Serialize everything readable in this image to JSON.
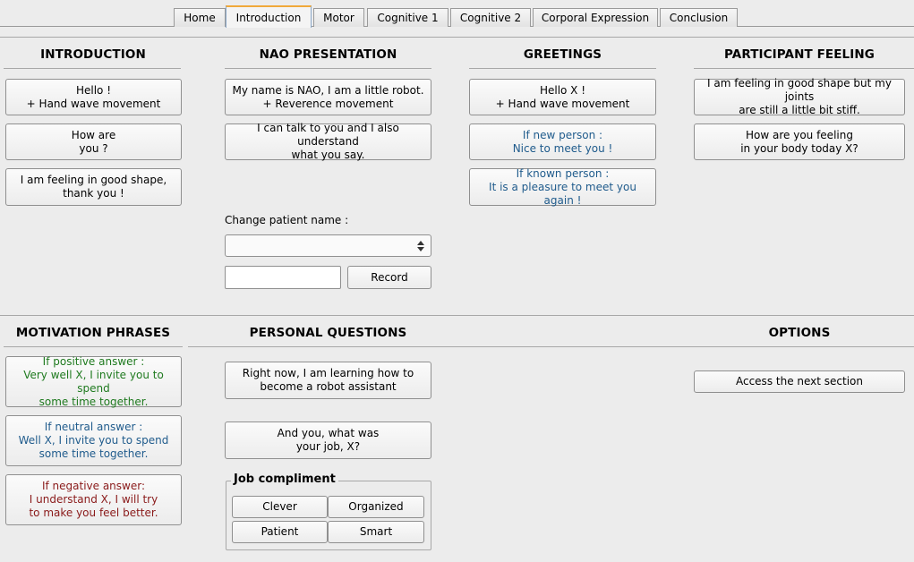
{
  "tabs": [
    "Home",
    "Introduction",
    "Motor",
    "Cognitive 1",
    "Cognitive 2",
    "Corporal Expression",
    "Conclusion"
  ],
  "active_tab": "Introduction",
  "sections": {
    "introduction": {
      "title": "INTRODUCTION",
      "buttons": [
        "Hello !\n+ Hand wave movement",
        "How are\nyou ?",
        "I am feeling in good shape,\nthank you !"
      ]
    },
    "nao_presentation": {
      "title": "NAO PRESENTATION",
      "buttons": [
        "My name is NAO, I am a little robot.\n+ Reverence movement",
        "I can talk to you and I also understand\nwhat you say."
      ],
      "change_name_label": "Change patient name :",
      "select_value": "",
      "name_input_value": "",
      "record_label": "Record"
    },
    "greetings": {
      "title": "GREETINGS",
      "buttons": [
        "Hello X !\n+ Hand wave movement",
        "If new person :\nNice to meet you !",
        "If known person :\nIt is a pleasure to meet you again !"
      ]
    },
    "participant_feeling": {
      "title": "PARTICIPANT FEELING",
      "buttons": [
        "I am feeling in good shape but my joints\nare still a little bit stiff.",
        "How are you feeling\nin your body today X?"
      ]
    },
    "motivation_phrases": {
      "title": "MOTIVATION PHRASES",
      "buttons": [
        "If positive answer :\nVery well X, I invite you to spend\nsome time together.",
        "If neutral answer :\nWell X, I invite you to spend\nsome time together.",
        "If negative answer:\nI understand X, I will try\nto make you feel better."
      ]
    },
    "personal_questions": {
      "title": "PERSONAL QUESTIONS",
      "buttons": [
        "Right now, I am learning how to\nbecome a robot assistant",
        "And you, what was\nyour job, X?"
      ],
      "job_compliment": {
        "title": "Job compliment",
        "buttons": [
          "Clever",
          "Organized",
          "Patient",
          "Smart"
        ]
      }
    },
    "options": {
      "title": "OPTIONS",
      "buttons": [
        "Access the next section"
      ]
    }
  },
  "colors": {
    "positive": "#1f7a1f",
    "neutral": "#1f5b8c",
    "negative": "#8a1a1a",
    "active_tab_accent": "#f0a93a"
  }
}
